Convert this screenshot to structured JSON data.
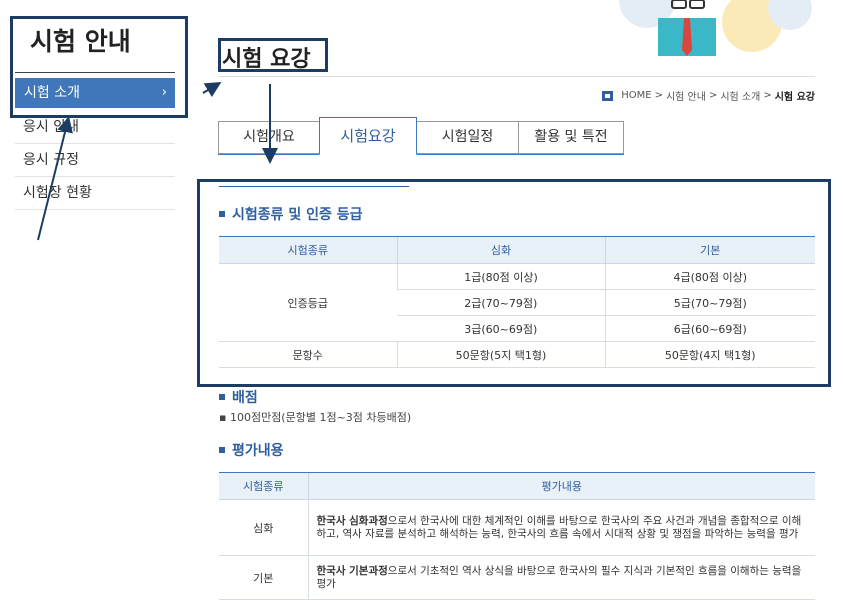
{
  "sidebar": {
    "title": "시험 안내",
    "items": [
      {
        "label": "시험 소개",
        "active": true
      },
      {
        "label": "응시 안내"
      },
      {
        "label": "응시 규정"
      },
      {
        "label": "시험장 현황"
      }
    ],
    "chevron": "›"
  },
  "header": {
    "title": "시험 요강",
    "breadcrumb": [
      "HOME",
      "시험 안내",
      "시험 소개",
      "시험 요강"
    ],
    "separator": ">"
  },
  "tabs": [
    {
      "label": "시험개요"
    },
    {
      "label": "시험요강",
      "active": true
    },
    {
      "label": "시험일정"
    },
    {
      "label": "활용 및 특전"
    }
  ],
  "section1": {
    "heading": "시험종류 및 인증 등급",
    "headers": [
      "시험종류",
      "심화",
      "기본"
    ],
    "grade_label": "인증등급",
    "grades": [
      [
        "1급(80점 이상)",
        "4급(80점 이상)"
      ],
      [
        "2급(70~79점)",
        "5급(70~79점)"
      ],
      [
        "3급(60~69점)",
        "6급(60~69점)"
      ]
    ],
    "question_label": "문항수",
    "questions": [
      "50문항(5지 택1형)",
      "50문항(4지 택1형)"
    ]
  },
  "section2": {
    "heading": "배점",
    "text": "100점만점(문항별 1점~3점 차등배점)"
  },
  "section3": {
    "heading": "평가내용",
    "headers": [
      "시험종류",
      "평가내용"
    ],
    "rows": [
      {
        "type": "심화",
        "bold": "한국사 심화과정",
        "text": "으로서 한국사에 대한 체계적인 이해를 바탕으로 한국사의 주요 사건과 개념을 종합적으로 이해하고, 역사 자료를 분석하고 해석하는 능력, 한국사의 흐름 속에서 시대적 상황 및 쟁점을 파악하는 능력을 평가"
      },
      {
        "type": "기본",
        "bold": "한국사 기본과정",
        "text": "으로서 기초적인 역사 상식을 바탕으로 한국사의 필수 지식과 기본적인 흐름을 이해하는 능력을 평가"
      }
    ]
  },
  "colors": {
    "accent": "#3f77b8",
    "annotation": "#1c3c63"
  }
}
